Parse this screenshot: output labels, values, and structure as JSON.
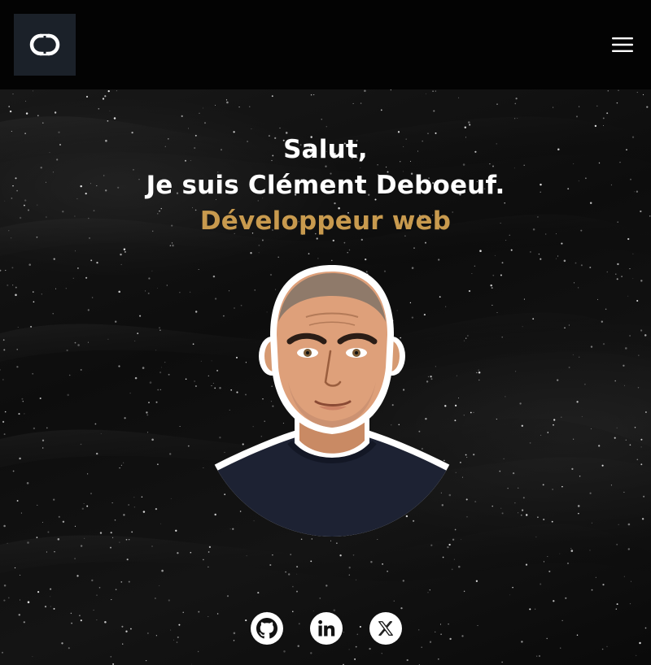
{
  "header": {
    "logo_icon": "cd-monogram-logo",
    "menu_icon": "hamburger-menu-icon",
    "background": "#030303",
    "logo_background": "#1b2129"
  },
  "hero": {
    "greeting": "Salut,",
    "intro": "Je suis Clément Deboeuf.",
    "role": "Développeur web",
    "accent_color": "#c89a4e",
    "avatar_icon": "developer-avatar-portrait"
  },
  "socials": [
    {
      "name": "github",
      "icon": "github-icon"
    },
    {
      "name": "linkedin",
      "icon": "linkedin-icon"
    },
    {
      "name": "x",
      "icon": "x-twitter-icon"
    }
  ]
}
